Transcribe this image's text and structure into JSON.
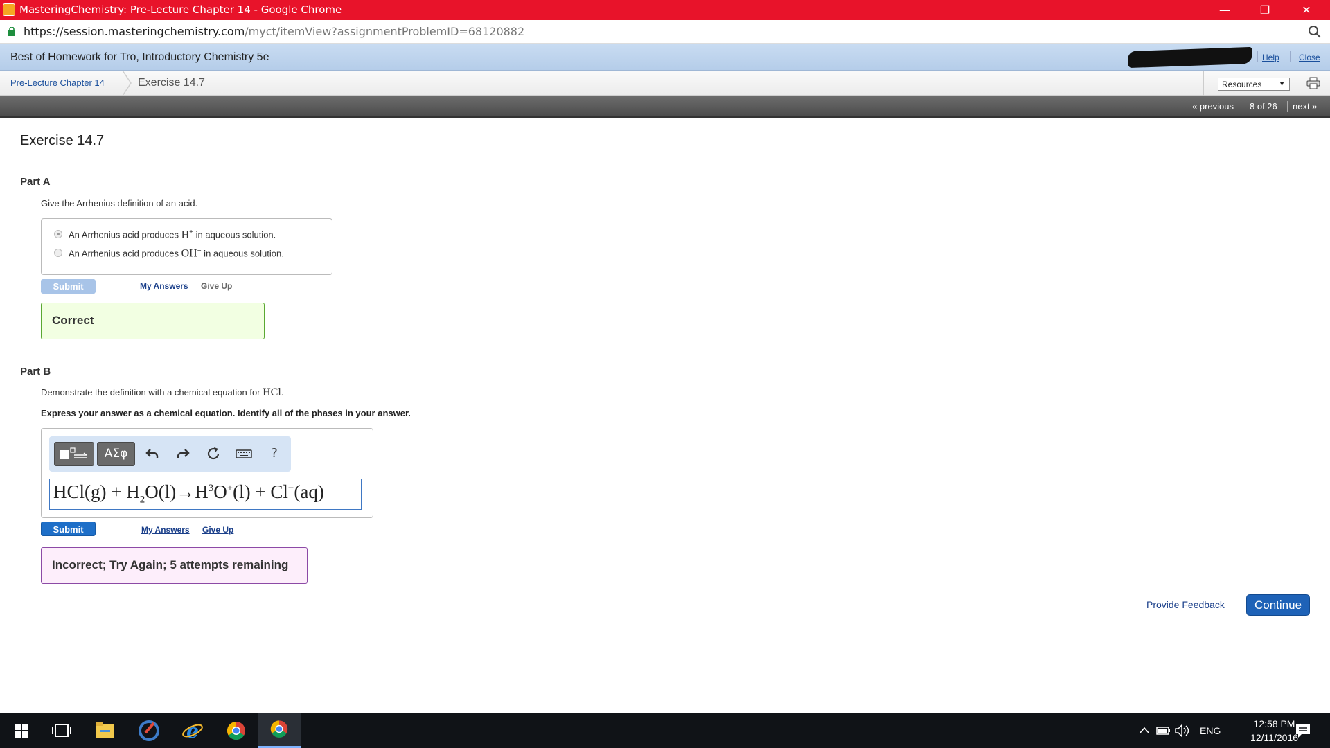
{
  "window": {
    "title": "MasteringChemistry: Pre-Lecture Chapter 14 - Google Chrome",
    "url_host": "https://session.masteringchemistry.com",
    "url_path": "/myct/itemView?assignmentProblemID=68120882"
  },
  "header": {
    "course": "Best of Homework for Tro, Introductory Chemistry 5e",
    "help_label": "Help",
    "close_label": "Close"
  },
  "breadcrumb": {
    "parent": "Pre-Lecture Chapter 14",
    "current": "Exercise 14.7",
    "resources_label": "Resources"
  },
  "nav": {
    "previous": "« previous",
    "position": "8 of 26",
    "next": "next »"
  },
  "exercise": {
    "title": "Exercise 14.7",
    "partA": {
      "heading": "Part A",
      "prompt": "Give the Arrhenius definition of an acid.",
      "choices": [
        {
          "pre": "An Arrhenius acid produces ",
          "chem": "H",
          "sup": "+",
          "post": " in aqueous solution.",
          "selected": true
        },
        {
          "pre": "An Arrhenius acid produces ",
          "chem": "OH",
          "sup": "−",
          "post": " in aqueous solution.",
          "selected": false
        }
      ],
      "submit_label": "Submit",
      "my_answers_label": "My Answers",
      "give_up_label": "Give Up",
      "feedback": "Correct"
    },
    "partB": {
      "heading": "Part B",
      "prompt_pre": "Demonstrate the definition with a chemical equation for ",
      "prompt_chem": "HCl",
      "prompt_post": ".",
      "instruction": "Express your answer as a chemical equation. Identify all of the phases in your answer.",
      "toolbar": {
        "greek_label": "ΑΣφ",
        "help_label": "?"
      },
      "answer": {
        "p1": "HCl(g) + H",
        "sub1": "2",
        "p2": "O(l)→H",
        "sup1": "3",
        "p3": "O",
        "sup2": "+",
        "p4": "(l) + Cl",
        "sup3": "−",
        "p5": "(aq)"
      },
      "submit_label": "Submit",
      "my_answers_label": "My Answers",
      "give_up_label": "Give Up",
      "feedback": "Incorrect; Try Again; 5 attempts remaining"
    },
    "provide_feedback_label": "Provide Feedback",
    "continue_label": "Continue"
  },
  "taskbar": {
    "language": "ENG",
    "time": "12:58 PM",
    "date": "12/11/2016",
    "icons": [
      "windows-start-icon",
      "task-view-icon",
      "file-explorer-icon",
      "ccleaner-icon",
      "internet-explorer-icon",
      "chrome-icon",
      "chrome-active-icon"
    ]
  },
  "colors": {
    "titlebar": "#e8132a",
    "correct_border": "#5aa832",
    "incorrect_border": "#8c4aa6",
    "primary_button": "#1e6fc8"
  }
}
